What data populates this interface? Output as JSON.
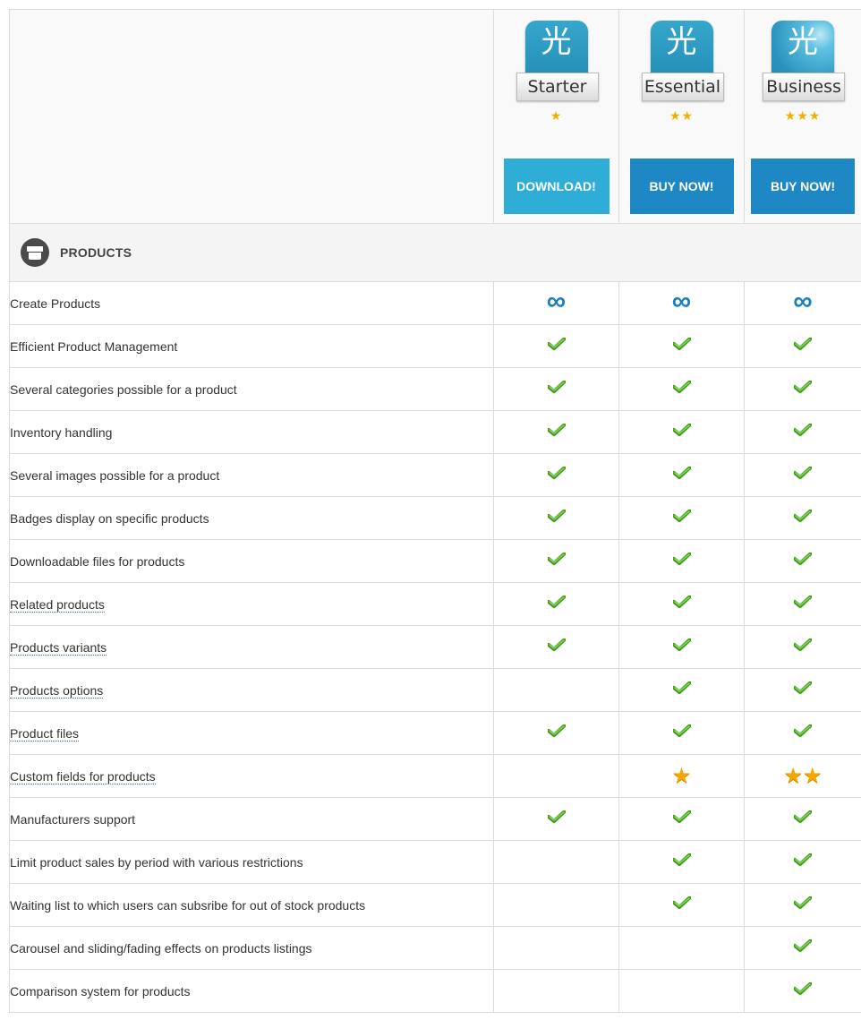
{
  "plans": [
    {
      "id": "starter",
      "name": "Starter",
      "stars": "★",
      "button": "DOWNLOAD!",
      "button_type": "download",
      "icon": "starter-logo-icon",
      "glyph": "光"
    },
    {
      "id": "essential",
      "name": "Essential",
      "stars": "★★",
      "button": "BUY NOW!",
      "button_type": "buy",
      "icon": "essential-logo-icon",
      "glyph": "光"
    },
    {
      "id": "business",
      "name": "Business",
      "stars": "★★★",
      "button": "BUY NOW!",
      "button_type": "buy",
      "icon": "business-logo-icon",
      "glyph": "光"
    }
  ],
  "section": {
    "title": "PRODUCTS",
    "icon": "box-icon"
  },
  "features": [
    {
      "name": "Create Products",
      "link": false,
      "values": [
        "infinity",
        "infinity",
        "infinity"
      ]
    },
    {
      "name": "Efficient Product Management",
      "link": false,
      "values": [
        "check",
        "check",
        "check"
      ]
    },
    {
      "name": "Several categories possible for a product",
      "link": false,
      "values": [
        "check",
        "check",
        "check"
      ]
    },
    {
      "name": "Inventory handling",
      "link": false,
      "values": [
        "check",
        "check",
        "check"
      ]
    },
    {
      "name": "Several images possible for a product",
      "link": false,
      "values": [
        "check",
        "check",
        "check"
      ]
    },
    {
      "name": "Badges display on specific products",
      "link": false,
      "values": [
        "check",
        "check",
        "check"
      ]
    },
    {
      "name": "Downloadable files for products",
      "link": false,
      "values": [
        "check",
        "check",
        "check"
      ]
    },
    {
      "name": "Related products",
      "link": true,
      "values": [
        "check",
        "check",
        "check"
      ]
    },
    {
      "name": "Products variants",
      "link": true,
      "values": [
        "check",
        "check",
        "check"
      ]
    },
    {
      "name": "Products options",
      "link": true,
      "values": [
        "",
        "check",
        "check"
      ]
    },
    {
      "name": "Product files",
      "link": true,
      "values": [
        "check",
        "check",
        "check"
      ]
    },
    {
      "name": "Custom fields for products",
      "link": true,
      "values": [
        "",
        "star1",
        "star2"
      ]
    },
    {
      "name": "Manufacturers support",
      "link": false,
      "values": [
        "check",
        "check",
        "check"
      ]
    },
    {
      "name": "Limit product sales by period with various restrictions",
      "link": false,
      "values": [
        "",
        "check",
        "check"
      ]
    },
    {
      "name": "Waiting list to which users can subsribe for out of stock products",
      "link": false,
      "values": [
        "",
        "check",
        "check"
      ]
    },
    {
      "name": "Carousel and sliding/fading effects on products listings",
      "link": false,
      "values": [
        "",
        "",
        "check"
      ]
    },
    {
      "name": "Comparison system for products",
      "link": false,
      "values": [
        "",
        "",
        "check"
      ]
    }
  ],
  "colors": {
    "infinity": "#1a7fb5",
    "check": "#55b52c",
    "star": "#f6a800",
    "download": "#2eaed6",
    "buy": "#1d88c4"
  }
}
